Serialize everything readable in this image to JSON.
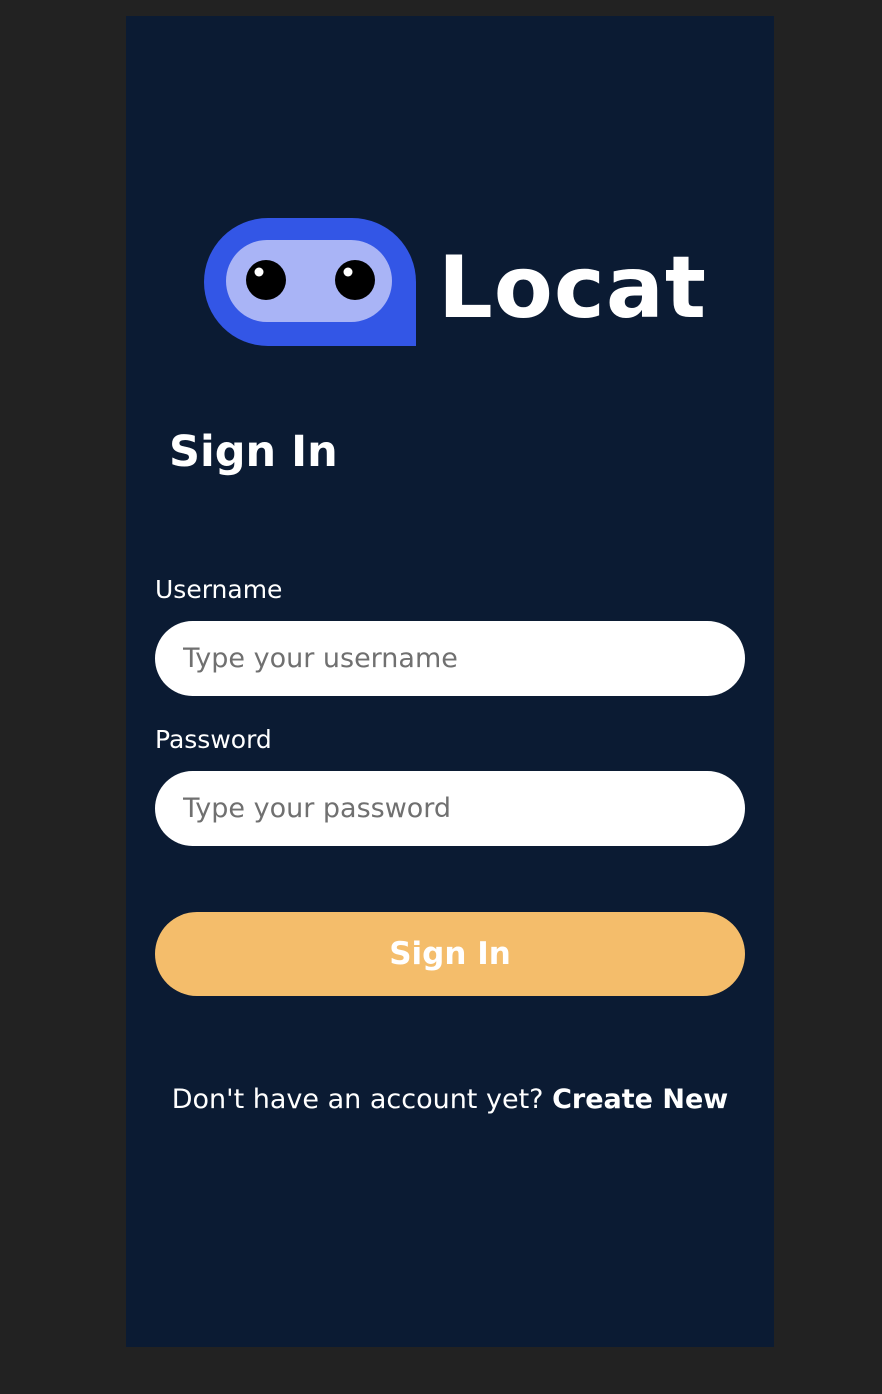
{
  "brand": {
    "name": "Locat",
    "logo_icon": "robot-face-icon",
    "colors": {
      "icon_body": "#3356e6",
      "icon_visor": "#a9b4f6",
      "eye": "#000000"
    }
  },
  "page": {
    "title": "Sign In"
  },
  "form": {
    "username": {
      "label": "Username",
      "placeholder": "Type your username",
      "value": ""
    },
    "password": {
      "label": "Password",
      "placeholder": "Type your password",
      "value": ""
    },
    "submit_label": "Sign In"
  },
  "footer": {
    "prompt": "Don't have an account yet?",
    "link_label": "Create New"
  },
  "colors": {
    "page_background": "#222222",
    "panel_background": "#0b1b33",
    "button": "#f4bd6b",
    "text": "#ffffff"
  }
}
